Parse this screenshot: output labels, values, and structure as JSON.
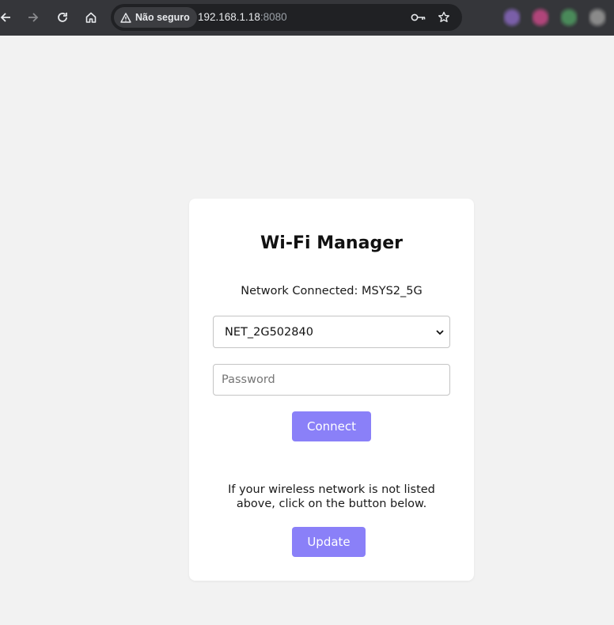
{
  "browser": {
    "security_label": "Não seguro",
    "url_host": "192.168.1.18",
    "url_port": ":8080",
    "icons": [
      "back-icon",
      "forward-icon",
      "reload-icon",
      "home-icon",
      "warning-icon",
      "key-icon",
      "star-icon"
    ],
    "extension_colors": [
      "#7a5fa8",
      "#b0457a",
      "#4a8a5a",
      "#8a8a8a"
    ]
  },
  "card": {
    "title": "Wi-Fi Manager",
    "connected_text": "Network Connected: MSYS2_5G",
    "network_select": {
      "selected": "NET_2G502840"
    },
    "password": {
      "placeholder": "Password",
      "value": ""
    },
    "connect_label": "Connect",
    "note": "If your wireless network is not listed above, click on the button below.",
    "update_label": "Update"
  },
  "colors": {
    "accent": "#8a80f8",
    "page_background": "#f2f2f2",
    "toolbar": "#35363a"
  }
}
